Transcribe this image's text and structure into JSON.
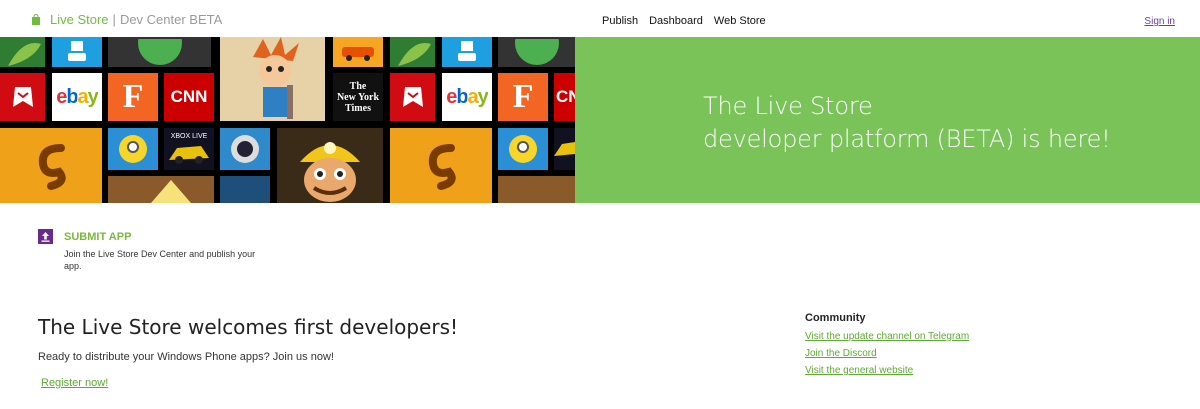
{
  "header": {
    "brand_name": "Live Store",
    "brand_separator": "|",
    "brand_sub": "Dev Center BETA",
    "nav": [
      "Publish",
      "Dashboard",
      "Web Store"
    ],
    "sign_in": "Sign in"
  },
  "hero": {
    "tiles": {
      "ebay": "ebay",
      "cnn": "CNN",
      "fandango": "F",
      "nyt_line1": "The",
      "nyt_line2": "New York",
      "nyt_line3": "Times",
      "xbox": "XBOX LIVE"
    },
    "banner_line1": "The Live Store",
    "banner_line2": "developer platform (BETA) is here!"
  },
  "submit": {
    "title": "SUBMIT APP",
    "description": "Join the Live Store Dev Center and publish your app."
  },
  "welcome": {
    "title": "The Live Store welcomes first developers!",
    "text": "Ready to distribute your Windows Phone apps? Join us now!",
    "register": "Register now!"
  },
  "community": {
    "title": "Community",
    "links": [
      "Visit the update channel on Telegram",
      "Join the Discord",
      "Visit the general website"
    ]
  },
  "colors": {
    "accent_green": "#79c359",
    "link_green": "#5fa836",
    "purple": "#6a2a8c"
  }
}
